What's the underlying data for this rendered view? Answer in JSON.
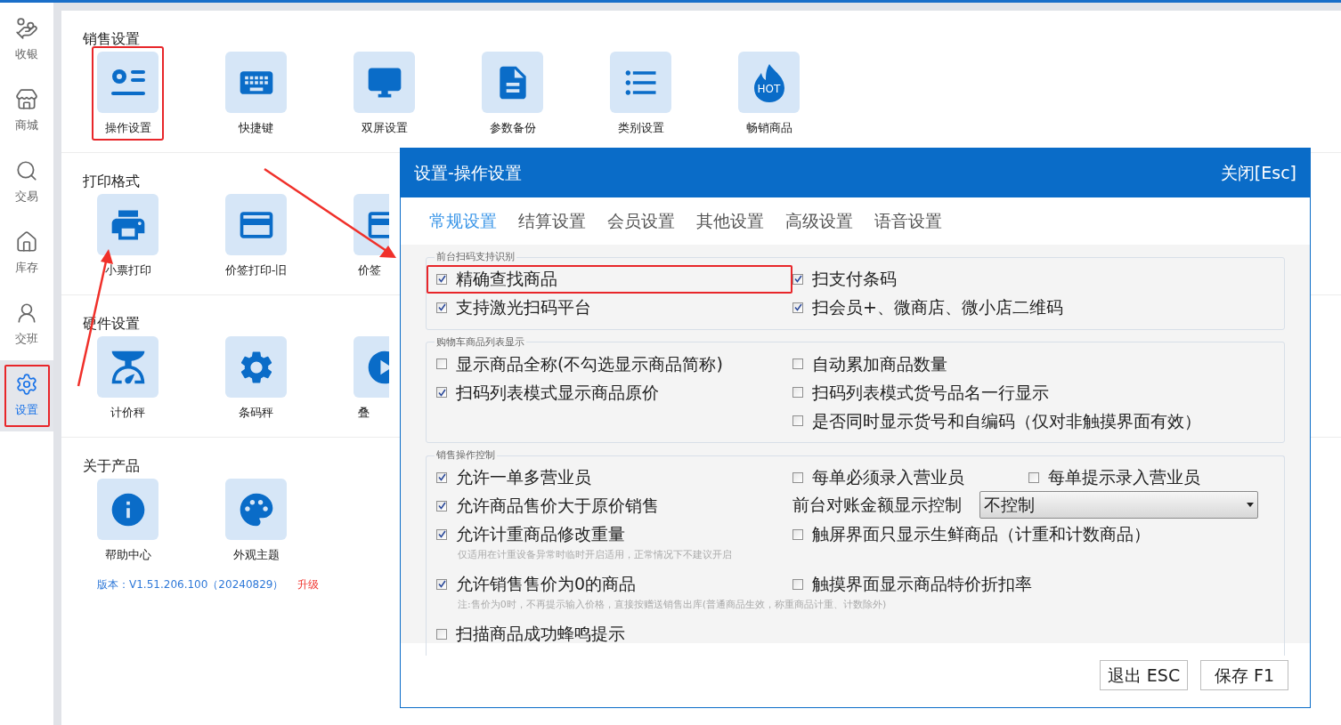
{
  "sidebar": {
    "items": [
      {
        "label": "收银",
        "selected": false
      },
      {
        "label": "商城",
        "selected": false
      },
      {
        "label": "交易",
        "selected": false
      },
      {
        "label": "库存",
        "selected": false
      },
      {
        "label": "交班",
        "selected": false
      },
      {
        "label": "设置",
        "selected": true,
        "highlighted": true
      }
    ]
  },
  "sections": [
    {
      "title": "销售设置",
      "items": [
        {
          "label": "操作设置",
          "kind": "tile",
          "highlighted": true
        },
        {
          "label": "快捷键",
          "kind": "tile"
        },
        {
          "label": "双屏设置",
          "kind": "tile"
        },
        {
          "label": "参数备份",
          "kind": "tile"
        },
        {
          "label": "类别设置",
          "kind": "tile"
        },
        {
          "label": "畅销商品",
          "kind": "tile",
          "badge": "HOT"
        }
      ]
    },
    {
      "title": "打印格式",
      "items": [
        {
          "label": "小票打印",
          "kind": "tile"
        },
        {
          "label": "价签打印-旧",
          "kind": "tile"
        },
        {
          "label": "价签",
          "kind": "clipped"
        }
      ]
    },
    {
      "title": "硬件设置",
      "items": [
        {
          "label": "计价秤",
          "kind": "tile"
        },
        {
          "label": "条码秤",
          "kind": "tile"
        },
        {
          "label": "叠",
          "kind": "clipped"
        }
      ]
    },
    {
      "title": "关于产品",
      "items": [
        {
          "label": "帮助中心",
          "kind": "tile"
        },
        {
          "label": "外观主题",
          "kind": "tile"
        }
      ]
    }
  ],
  "version": {
    "text": "版本：V1.51.206.100（20240829）",
    "link": "升级"
  },
  "dialog": {
    "title": "设置-操作设置",
    "close": "关闭[Esc]",
    "tabs": [
      {
        "label": "常规设置",
        "selected": true
      },
      {
        "label": "结算设置",
        "selected": false
      },
      {
        "label": "会员设置",
        "selected": false
      },
      {
        "label": "其他设置",
        "selected": false
      },
      {
        "label": "高级设置",
        "selected": false
      },
      {
        "label": "语音设置",
        "selected": false
      }
    ],
    "groups": [
      {
        "legend": "前台扫码支持识别",
        "rows": [
          {
            "left": [
              {
                "kind": "checkbox",
                "label": "精确查找商品",
                "checked": true,
                "highlighted": true
              }
            ],
            "right": [
              {
                "kind": "checkbox",
                "label": "扫支付条码",
                "checked": true
              }
            ]
          },
          {
            "left": [
              {
                "kind": "checkbox",
                "label": "支持激光扫码平台",
                "checked": true
              }
            ],
            "right": [
              {
                "kind": "checkbox",
                "label": "扫会员+、微商店、微小店二维码",
                "checked": true
              }
            ]
          }
        ]
      },
      {
        "legend": "购物车商品列表显示",
        "rows": [
          {
            "left": [
              {
                "kind": "checkbox",
                "label": "显示商品全称(不勾选显示商品简称)",
                "checked": false
              }
            ],
            "right": [
              {
                "kind": "checkbox",
                "label": "自动累加商品数量",
                "checked": false
              }
            ]
          },
          {
            "left": [
              {
                "kind": "checkbox",
                "label": "扫码列表模式显示商品原价",
                "checked": true
              }
            ],
            "right": [
              {
                "kind": "checkbox",
                "label": "扫码列表模式货号品名一行显示",
                "checked": false
              }
            ]
          },
          {
            "left": [],
            "right": [
              {
                "kind": "checkbox",
                "label": "是否同时显示货号和自编码（仅对非触摸界面有效）",
                "checked": false
              }
            ]
          }
        ]
      },
      {
        "legend": "销售操作控制",
        "rows": [
          {
            "left": [
              {
                "kind": "checkbox",
                "label": "允许一单多营业员",
                "checked": true
              }
            ],
            "right": [
              {
                "kind": "checkbox",
                "label": "每单必须录入营业员",
                "checked": false
              },
              {
                "kind": "checkbox",
                "label": "每单提示录入营业员",
                "checked": false
              }
            ]
          },
          {
            "left": [
              {
                "kind": "checkbox",
                "label": "允许商品售价大于原价销售",
                "checked": true
              }
            ],
            "right": [
              {
                "kind": "select",
                "label": "前台对账金额显示控制",
                "value": "不控制"
              }
            ]
          },
          {
            "left": [
              {
                "kind": "checkbox",
                "label": "允许计重商品修改重量",
                "checked": true
              }
            ],
            "right": [
              {
                "kind": "checkbox",
                "label": "触屏界面只显示生鲜商品（计重和计数商品）",
                "checked": false
              }
            ]
          },
          {
            "left": [
              {
                "kind": "note",
                "text": "仅适用在计重设备异常时临时开启适用，正常情况下不建议开启"
              }
            ],
            "right": []
          },
          {
            "left": [
              {
                "kind": "checkbox",
                "label": "允许销售售价为0的商品",
                "checked": true
              }
            ],
            "right": [
              {
                "kind": "checkbox",
                "label": "触摸界面显示商品特价折扣率",
                "checked": false
              }
            ]
          },
          {
            "left": [
              {
                "kind": "note",
                "text": "注:售价为0时，不再提示输入价格，直接按赠送销售出库(普通商品生效，称重商品计重、计数除外)"
              }
            ],
            "right": []
          },
          {
            "left": [
              {
                "kind": "checkbox",
                "label": "扫描商品成功蜂鸣提示",
                "checked": false
              }
            ],
            "right": []
          }
        ]
      }
    ],
    "buttons": [
      "退出 ESC",
      "保存 F1"
    ]
  }
}
